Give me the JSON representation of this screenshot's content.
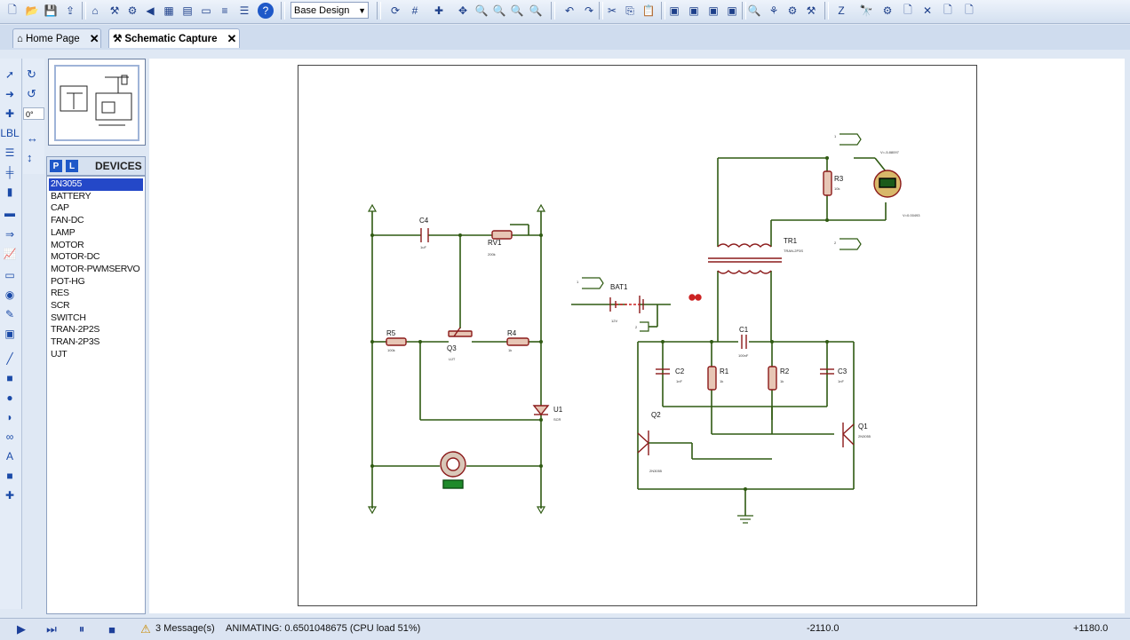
{
  "toolbar": {
    "design_select": "Base Design",
    "icons": [
      "new-file-icon",
      "open-folder-icon",
      "save-icon",
      "import-icon",
      "home-icon",
      "library-icon",
      "component-icon",
      "back-icon",
      "pcb-icon",
      "bill-icon",
      "document-icon",
      "wiring-icon",
      "help-icon"
    ]
  },
  "tabs": [
    {
      "label": "Home Page",
      "active": false
    },
    {
      "label": "Schematic Capture",
      "active": true
    }
  ],
  "rotation": {
    "angle": "0°"
  },
  "devices": {
    "title": "DEVICES",
    "pick_label": "P",
    "library_label": "L",
    "items": [
      "2N3055",
      "BATTERY",
      "CAP",
      "FAN-DC",
      "LAMP",
      "MOTOR",
      "MOTOR-DC",
      "MOTOR-PWMSERVO",
      "POT-HG",
      "RES",
      "SCR",
      "SWITCH",
      "TRAN-2P2S",
      "TRAN-2P3S",
      "UJT"
    ],
    "selected": 0
  },
  "schematic": {
    "labels": {
      "c4": "C4",
      "c4_val": "1uF",
      "rv1": "RV1",
      "rv1_val": "200k",
      "r5": "R5",
      "r5_val": "100k",
      "q3": "Q3",
      "q3_val": "UJT",
      "r4": "R4",
      "r4_val": "1k",
      "u1": "U1",
      "u1_val": "SCR",
      "r3": "R3",
      "r3_val": "10k",
      "tr1": "TR1",
      "tr1_val": "TRAN-2P3S",
      "bat1": "BAT1",
      "bat1_val": "12V",
      "c1": "C1",
      "c1_val": "100nF",
      "c2": "C2",
      "c2_val": "1nF",
      "c3": "C3",
      "c3_val": "1nF",
      "r1": "R1",
      "r1_val": "1k",
      "r2": "R2",
      "r2_val": "1k",
      "q2": "Q2",
      "q2_val": "2N3055",
      "q1": "Q1",
      "q1_val": "2N3055",
      "term1": "1",
      "term2": "2",
      "term3": "1",
      "term4": "2",
      "probe1": "V=-5.88097",
      "probe2": "V=0.00493"
    }
  },
  "status": {
    "messages": "3 Message(s)",
    "animating": "ANIMATING: 0.6501048675 (CPU load 51%)",
    "coord_x": "-2110.0",
    "coord_y": "+1180.0"
  },
  "colors": {
    "wire": "#2f5a12",
    "component": "#8b1a1a",
    "selection": "#2448c8",
    "accent": "#1e58c8"
  }
}
